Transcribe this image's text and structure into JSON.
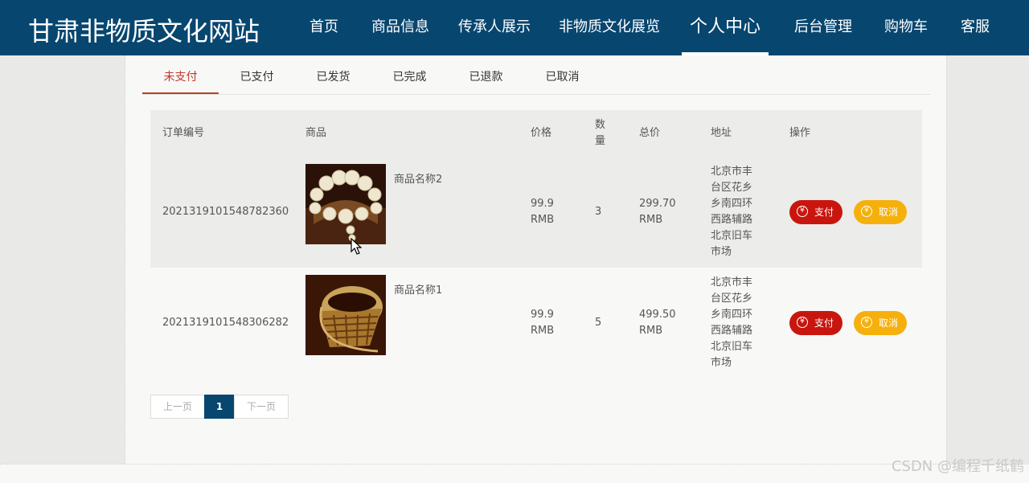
{
  "site": {
    "title": "甘肃非物质文化网站"
  },
  "nav": [
    {
      "label": "首页"
    },
    {
      "label": "商品信息"
    },
    {
      "label": "传承人展示"
    },
    {
      "label": "非物质文化展览"
    },
    {
      "label": "个人中心",
      "active": true
    },
    {
      "label": "后台管理"
    },
    {
      "label": "购物车"
    },
    {
      "label": "客服"
    }
  ],
  "tabs": [
    {
      "label": "未支付",
      "active": true
    },
    {
      "label": "已支付"
    },
    {
      "label": "已发货"
    },
    {
      "label": "已完成"
    },
    {
      "label": "已退款"
    },
    {
      "label": "已取消"
    }
  ],
  "table": {
    "headers": {
      "order_no": "订单编号",
      "product": "商品",
      "price": "价格",
      "qty": "数量",
      "total": "总价",
      "address": "地址",
      "actions": "操作"
    },
    "rows": [
      {
        "order_no": "2021319101548782360",
        "product_name": "商品名称2",
        "price": "99.9",
        "price_unit": "RMB",
        "qty": "3",
        "total": "299.70",
        "total_unit": "RMB",
        "address_lines": [
          "北京市丰",
          "台区花乡",
          "乡南四环",
          "西路辅路",
          "北京旧车",
          "市场"
        ],
        "pay_label": "支付",
        "cancel_label": "取消"
      },
      {
        "order_no": "2021319101548306282",
        "product_name": "商品名称1",
        "price": "99.9",
        "price_unit": "RMB",
        "qty": "5",
        "total": "499.50",
        "total_unit": "RMB",
        "address_lines": [
          "北京市丰",
          "台区花乡",
          "乡南四环",
          "西路辅路",
          "北京旧车",
          "市场"
        ],
        "pay_label": "支付",
        "cancel_label": "取消"
      }
    ]
  },
  "pagination": {
    "prev": "上一页",
    "current": "1",
    "next": "下一页"
  },
  "icons": {
    "currency": "¥",
    "currency_icon": "yen-circle-icon"
  },
  "colors": {
    "header": "#07466f",
    "pay": "#c8160f",
    "cancel": "#f6b00c",
    "active_tab": "#b5451d"
  },
  "watermark": "CSDN @编程千纸鹤"
}
